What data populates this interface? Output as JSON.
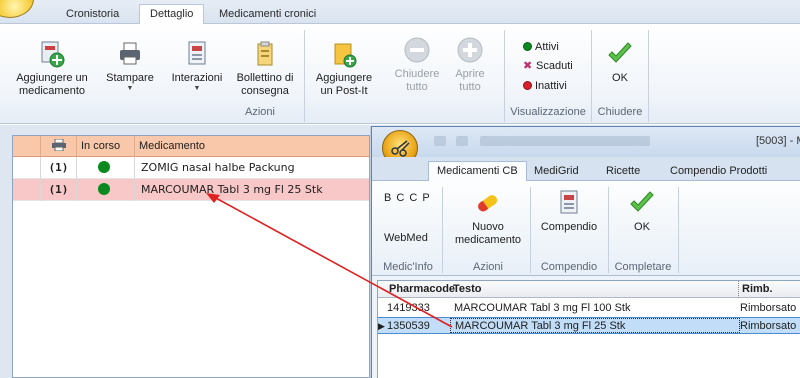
{
  "tabs": [
    {
      "label": "Cronistoria"
    },
    {
      "label": "Dettaglio"
    },
    {
      "label": "Medicamenti cronici"
    }
  ],
  "ribbon": {
    "add_med": {
      "line1": "Aggiungere un",
      "line2": "medicamento"
    },
    "print": {
      "label": "Stampare"
    },
    "interactions": {
      "label": "Interazioni"
    },
    "delivery": {
      "line1": "Bollettino di",
      "line2": "consegna"
    },
    "postit": {
      "line1": "Aggiungere",
      "line2": "un Post-It"
    },
    "close_all": {
      "line1": "Chiudere",
      "line2": "tutto"
    },
    "open_all": {
      "line1": "Aprire",
      "line2": "tutto"
    },
    "group_azioni": "Azioni",
    "legend": {
      "active": "Attivi",
      "expired": "Scaduti",
      "inactive": "Inattivi"
    },
    "group_visual": "Visualizzazione",
    "ok": "OK",
    "group_close": "Chiudere"
  },
  "grid": {
    "columns": {
      "status": "In corso",
      "med": "Medicamento"
    },
    "rows": [
      {
        "count": "(1)",
        "name": "ZOMIG nasal halbe Packung",
        "status_color": "#0a8a1e"
      },
      {
        "count": "(1)",
        "name": "MARCOUMAR Tabl 3 mg Fl 25 Stk",
        "status_color": "#0a8a1e"
      }
    ]
  },
  "window": {
    "title_code": "[5003] - M",
    "tabs": [
      {
        "label": "Medicamenti CB"
      },
      {
        "label": "MediGrid"
      },
      {
        "label": "Ricette"
      },
      {
        "label": "Compendio Prodotti"
      }
    ],
    "letters": "B C C P",
    "webmed": "WebMed",
    "group_medic": "Medic'Info",
    "new_med": {
      "line1": "Nuovo",
      "line2": "medicamento"
    },
    "group_azioni": "Azioni",
    "compendio_btn": "Compendio",
    "group_compendio": "Compendio",
    "ok": "OK",
    "group_complete": "Completare",
    "list": {
      "headers": {
        "code": "Pharmacode",
        "text": "Testo",
        "rimb": "Rimb."
      },
      "rows": [
        {
          "code": "1419333",
          "text": "MARCOUMAR Tabl 3 mg Fl 100 Stk",
          "rimb": "Rimborsato"
        },
        {
          "code": "1350539",
          "text": "MARCOUMAR Tabl 3 mg Fl 25 Stk",
          "rimb": "Rimborsato"
        }
      ]
    }
  },
  "colors": {
    "active": "#0a8a1e",
    "inactive": "#d8202a",
    "arrow": "#e02020",
    "selected_row": "#f8c8c8",
    "header": "#f9c7a9"
  }
}
